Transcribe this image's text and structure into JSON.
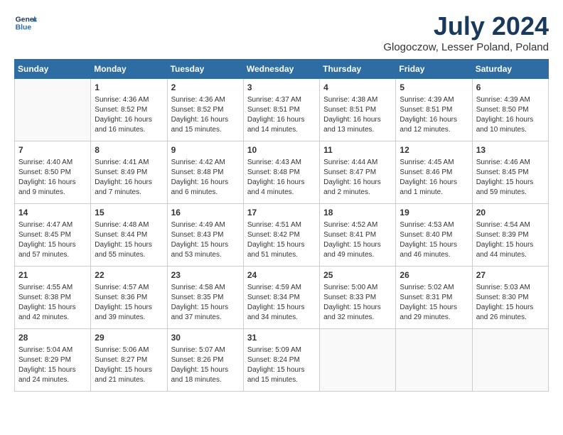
{
  "logo": {
    "line1": "General",
    "line2": "Blue"
  },
  "title": "July 2024",
  "location": "Glogoczow, Lesser Poland, Poland",
  "days_of_week": [
    "Sunday",
    "Monday",
    "Tuesday",
    "Wednesday",
    "Thursday",
    "Friday",
    "Saturday"
  ],
  "weeks": [
    [
      {
        "day": "",
        "info": ""
      },
      {
        "day": "1",
        "info": "Sunrise: 4:36 AM\nSunset: 8:52 PM\nDaylight: 16 hours\nand 16 minutes."
      },
      {
        "day": "2",
        "info": "Sunrise: 4:36 AM\nSunset: 8:52 PM\nDaylight: 16 hours\nand 15 minutes."
      },
      {
        "day": "3",
        "info": "Sunrise: 4:37 AM\nSunset: 8:51 PM\nDaylight: 16 hours\nand 14 minutes."
      },
      {
        "day": "4",
        "info": "Sunrise: 4:38 AM\nSunset: 8:51 PM\nDaylight: 16 hours\nand 13 minutes."
      },
      {
        "day": "5",
        "info": "Sunrise: 4:39 AM\nSunset: 8:51 PM\nDaylight: 16 hours\nand 12 minutes."
      },
      {
        "day": "6",
        "info": "Sunrise: 4:39 AM\nSunset: 8:50 PM\nDaylight: 16 hours\nand 10 minutes."
      }
    ],
    [
      {
        "day": "7",
        "info": "Sunrise: 4:40 AM\nSunset: 8:50 PM\nDaylight: 16 hours\nand 9 minutes."
      },
      {
        "day": "8",
        "info": "Sunrise: 4:41 AM\nSunset: 8:49 PM\nDaylight: 16 hours\nand 7 minutes."
      },
      {
        "day": "9",
        "info": "Sunrise: 4:42 AM\nSunset: 8:48 PM\nDaylight: 16 hours\nand 6 minutes."
      },
      {
        "day": "10",
        "info": "Sunrise: 4:43 AM\nSunset: 8:48 PM\nDaylight: 16 hours\nand 4 minutes."
      },
      {
        "day": "11",
        "info": "Sunrise: 4:44 AM\nSunset: 8:47 PM\nDaylight: 16 hours\nand 2 minutes."
      },
      {
        "day": "12",
        "info": "Sunrise: 4:45 AM\nSunset: 8:46 PM\nDaylight: 16 hours\nand 1 minute."
      },
      {
        "day": "13",
        "info": "Sunrise: 4:46 AM\nSunset: 8:45 PM\nDaylight: 15 hours\nand 59 minutes."
      }
    ],
    [
      {
        "day": "14",
        "info": "Sunrise: 4:47 AM\nSunset: 8:45 PM\nDaylight: 15 hours\nand 57 minutes."
      },
      {
        "day": "15",
        "info": "Sunrise: 4:48 AM\nSunset: 8:44 PM\nDaylight: 15 hours\nand 55 minutes."
      },
      {
        "day": "16",
        "info": "Sunrise: 4:49 AM\nSunset: 8:43 PM\nDaylight: 15 hours\nand 53 minutes."
      },
      {
        "day": "17",
        "info": "Sunrise: 4:51 AM\nSunset: 8:42 PM\nDaylight: 15 hours\nand 51 minutes."
      },
      {
        "day": "18",
        "info": "Sunrise: 4:52 AM\nSunset: 8:41 PM\nDaylight: 15 hours\nand 49 minutes."
      },
      {
        "day": "19",
        "info": "Sunrise: 4:53 AM\nSunset: 8:40 PM\nDaylight: 15 hours\nand 46 minutes."
      },
      {
        "day": "20",
        "info": "Sunrise: 4:54 AM\nSunset: 8:39 PM\nDaylight: 15 hours\nand 44 minutes."
      }
    ],
    [
      {
        "day": "21",
        "info": "Sunrise: 4:55 AM\nSunset: 8:38 PM\nDaylight: 15 hours\nand 42 minutes."
      },
      {
        "day": "22",
        "info": "Sunrise: 4:57 AM\nSunset: 8:36 PM\nDaylight: 15 hours\nand 39 minutes."
      },
      {
        "day": "23",
        "info": "Sunrise: 4:58 AM\nSunset: 8:35 PM\nDaylight: 15 hours\nand 37 minutes."
      },
      {
        "day": "24",
        "info": "Sunrise: 4:59 AM\nSunset: 8:34 PM\nDaylight: 15 hours\nand 34 minutes."
      },
      {
        "day": "25",
        "info": "Sunrise: 5:00 AM\nSunset: 8:33 PM\nDaylight: 15 hours\nand 32 minutes."
      },
      {
        "day": "26",
        "info": "Sunrise: 5:02 AM\nSunset: 8:31 PM\nDaylight: 15 hours\nand 29 minutes."
      },
      {
        "day": "27",
        "info": "Sunrise: 5:03 AM\nSunset: 8:30 PM\nDaylight: 15 hours\nand 26 minutes."
      }
    ],
    [
      {
        "day": "28",
        "info": "Sunrise: 5:04 AM\nSunset: 8:29 PM\nDaylight: 15 hours\nand 24 minutes."
      },
      {
        "day": "29",
        "info": "Sunrise: 5:06 AM\nSunset: 8:27 PM\nDaylight: 15 hours\nand 21 minutes."
      },
      {
        "day": "30",
        "info": "Sunrise: 5:07 AM\nSunset: 8:26 PM\nDaylight: 15 hours\nand 18 minutes."
      },
      {
        "day": "31",
        "info": "Sunrise: 5:09 AM\nSunset: 8:24 PM\nDaylight: 15 hours\nand 15 minutes."
      },
      {
        "day": "",
        "info": ""
      },
      {
        "day": "",
        "info": ""
      },
      {
        "day": "",
        "info": ""
      }
    ]
  ]
}
